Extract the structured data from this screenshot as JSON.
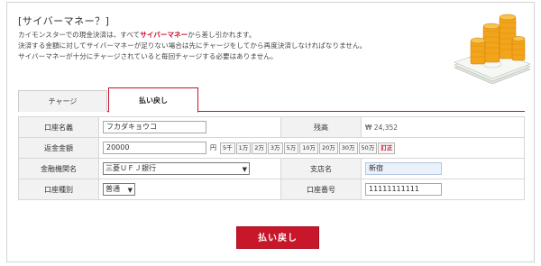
{
  "header": {
    "title": "[サイバーマネー？]",
    "desc_line1_pre": "カイモンスターでの現金決済は、すべて",
    "desc_line1_hl": "サイバーマネー",
    "desc_line1_post": "から差し引かれます。",
    "desc_line2": "決済する金額に対してサイバーマネーが足りない場合は先にチャージをしてから再度決済しなければなりません。",
    "desc_line3": "サイバーマネーが十分にチャージされていると毎回チャージする必要はありません。"
  },
  "tabs": [
    {
      "label": "チャージ",
      "active": false
    },
    {
      "label": "払い戻し",
      "active": true
    }
  ],
  "form": {
    "account_name_label": "口座名義",
    "account_name_value": "フカダキョウコ",
    "balance_label": "残高",
    "balance_value": "₩ 24,352",
    "refund_amount_label": "返金金額",
    "refund_amount_value": "20000",
    "yen_unit": "円",
    "amount_chips": [
      "5千",
      "1万",
      "2万",
      "3万",
      "5万",
      "10万",
      "20万",
      "30万",
      "50万"
    ],
    "clear_chip": "訂正",
    "bank_label": "金融機関名",
    "bank_value": "三菱ＵＦＪ銀行",
    "branch_label": "支店名",
    "branch_value": "新宿",
    "account_type_label": "口座種別",
    "account_type_value": "普通",
    "account_number_label": "口座番号",
    "account_number_value": "11111111111"
  },
  "submit_label": "払い戻し",
  "colors": {
    "accent": "#c8172a",
    "label_bg": "#f2f2f2",
    "border": "#d7d7d7"
  }
}
